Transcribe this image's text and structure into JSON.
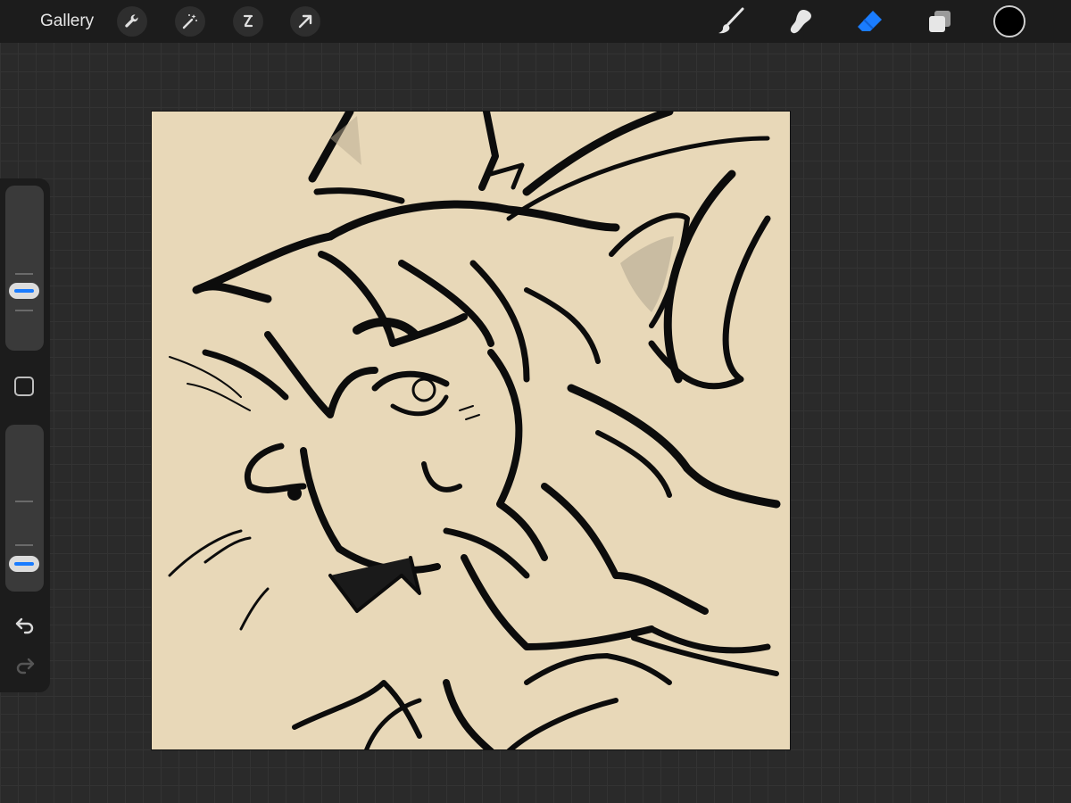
{
  "topbar": {
    "gallery_label": "Gallery",
    "left_tools": [
      "wrench-icon",
      "magic-wand-icon",
      "selection-icon",
      "transform-arrow-icon"
    ],
    "right_tools": [
      "brush-icon",
      "smudge-icon",
      "eraser-icon",
      "layers-icon"
    ],
    "active_tool": "eraser-icon",
    "current_color": "#000000"
  },
  "sidebar": {
    "brush_size_slider": "slider",
    "opacity_slider": "slider",
    "modify_button": "square-icon",
    "undo": "undo-icon",
    "redo": "redo-icon"
  },
  "colors": {
    "accent": "#1a7cff",
    "canvas_background": "#e8d8b8",
    "ui_bar": "#1c1c1c",
    "workspace": "#2a2a2a"
  },
  "canvas": {
    "content": "wolf-line-art"
  }
}
